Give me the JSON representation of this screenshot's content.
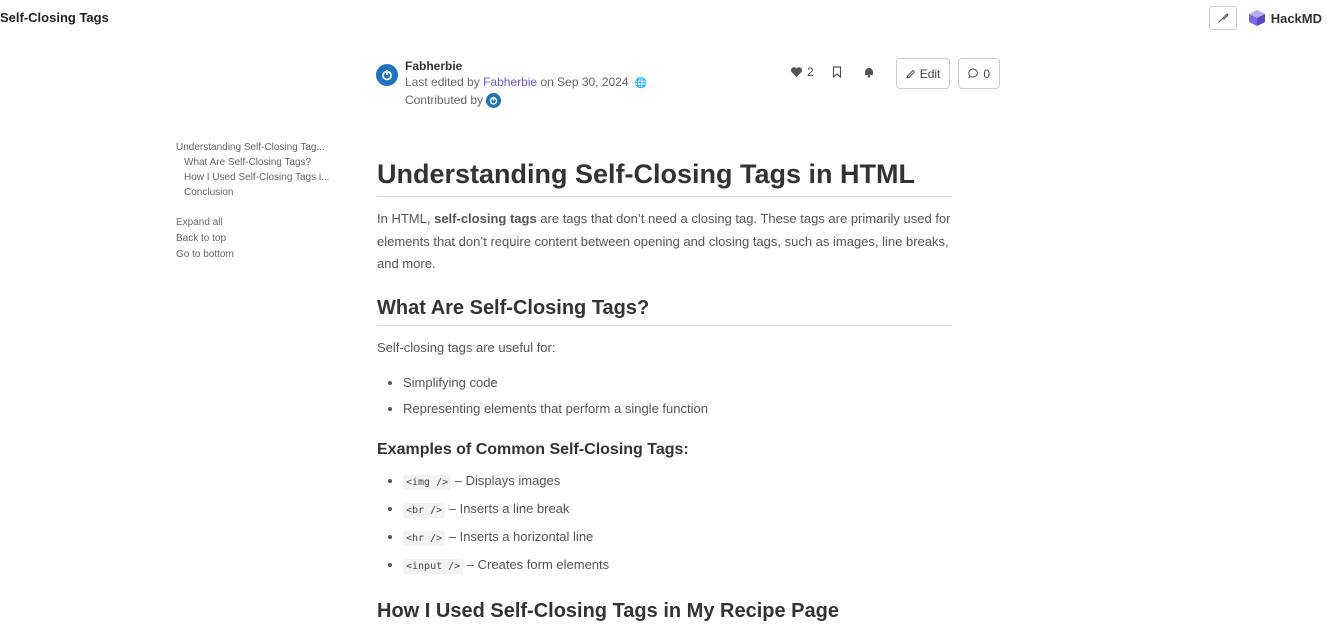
{
  "page": {
    "title": "Self-Closing Tags",
    "brand": "HackMD"
  },
  "meta": {
    "author": "Fabherbie",
    "edited_prefix": "Last edited by",
    "edited_by": "Fabherbie",
    "edited_on": "on Sep 30, 2024",
    "contributed_by": "Contributed by"
  },
  "actions": {
    "likes": "2",
    "edit_label": "Edit",
    "comments": "0"
  },
  "toc": {
    "items": [
      {
        "label": "Understanding Self-Closing Tag...",
        "level": 1
      },
      {
        "label": "What Are Self-Closing Tags?",
        "level": 2
      },
      {
        "label": "How I Used Self-Closing Tags i...",
        "level": 2
      },
      {
        "label": "Conclusion",
        "level": 2
      }
    ],
    "expand_all": "Expand all",
    "back_to_top": "Back to top",
    "go_to_bottom": "Go to bottom"
  },
  "doc": {
    "h1": "Understanding Self-Closing Tags in HTML",
    "intro": {
      "before": "In HTML,",
      "bold": "self-closing tags",
      "after": "are tags that don’t need a closing tag. These tags are primarily used for elements that don’t require content between opening and closing tags, such as images, line breaks, and more."
    },
    "h2_what": "What Are Self-Closing Tags?",
    "useful_for": "Self-closing tags are useful for:",
    "uses": [
      "Simplifying code",
      "Representing elements that perform a single function"
    ],
    "h3_examples": "Examples of Common Self-Closing Tags:",
    "examples": [
      {
        "code": "<img />",
        "desc": "– Displays images"
      },
      {
        "code": "<br />",
        "desc": "– Inserts a line break"
      },
      {
        "code": "<hr />",
        "desc": "– Inserts a horizontal line"
      },
      {
        "code": "<input />",
        "desc": "– Creates form elements"
      }
    ],
    "h2_how": "How I Used Self-Closing Tags in My Recipe Page"
  },
  "colors": {
    "link": "#6b5bd6",
    "avatar": "#1e73be"
  },
  "icons": [
    "brush-icon",
    "hackmd-logo-icon",
    "globe-icon",
    "heart-icon",
    "bookmark-icon",
    "bell-icon",
    "pencil-icon",
    "comment-icon"
  ]
}
